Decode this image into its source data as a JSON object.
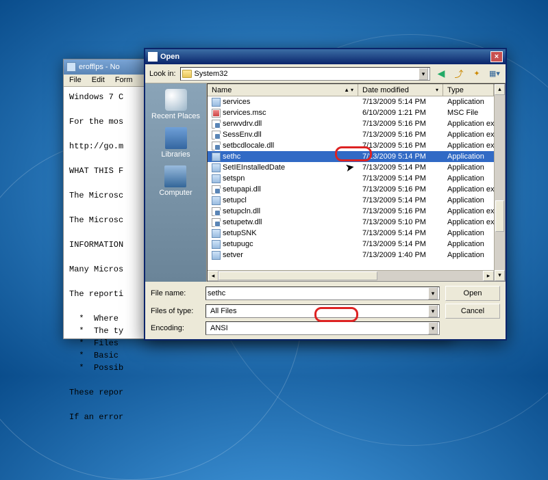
{
  "notepad": {
    "title": "erofflps - No",
    "menu": [
      "File",
      "Edit",
      "Form"
    ],
    "lines": [
      "Windows 7 C",
      "",
      "For the mos",
      "",
      "http://go.m",
      "",
      "WHAT THIS F",
      "",
      "The Microsc",
      "",
      "The Microsc",
      "",
      "INFORMATION",
      "",
      "Many Micros",
      "",
      "The reporti",
      "",
      "  *  Where",
      "  *  The ty",
      "  *  Files",
      "  *  Basic",
      "  *  Possib",
      "",
      "These repor",
      "",
      "If an error"
    ]
  },
  "dialog": {
    "title": "Open",
    "lookin_label": "Look in:",
    "lookin_value": "System32",
    "places": [
      "Recent Places",
      "Libraries",
      "Computer"
    ],
    "columns": {
      "name": "Name",
      "date": "Date modified",
      "type": "Type"
    },
    "col_w": {
      "name": 220,
      "date": 124,
      "type": 110
    },
    "files": [
      {
        "name": "services",
        "date": "7/13/2009 5:14 PM",
        "type": "Application",
        "ico": "exe"
      },
      {
        "name": "services.msc",
        "date": "6/10/2009 1:21 PM",
        "type": "MSC File",
        "ico": "msc"
      },
      {
        "name": "serwvdrv.dll",
        "date": "7/13/2009 5:16 PM",
        "type": "Application exte..",
        "ico": "dll"
      },
      {
        "name": "SessEnv.dll",
        "date": "7/13/2009 5:16 PM",
        "type": "Application exte..",
        "ico": "dll"
      },
      {
        "name": "setbcdlocale.dll",
        "date": "7/13/2009 5:16 PM",
        "type": "Application exte..",
        "ico": "dll"
      },
      {
        "name": "sethc",
        "date": "7/13/2009 5:14 PM",
        "type": "Application",
        "ico": "exe",
        "selected": true
      },
      {
        "name": "SetIEInstalledDate",
        "date": "7/13/2009 5:14 PM",
        "type": "Application",
        "ico": "exe"
      },
      {
        "name": "setspn",
        "date": "7/13/2009 5:14 PM",
        "type": "Application",
        "ico": "exe"
      },
      {
        "name": "setupapi.dll",
        "date": "7/13/2009 5:16 PM",
        "type": "Application exte..",
        "ico": "dll"
      },
      {
        "name": "setupcl",
        "date": "7/13/2009 5:14 PM",
        "type": "Application",
        "ico": "exe"
      },
      {
        "name": "setupcln.dll",
        "date": "7/13/2009 5:16 PM",
        "type": "Application exte..",
        "ico": "dll"
      },
      {
        "name": "setupetw.dll",
        "date": "7/13/2009 5:10 PM",
        "type": "Application exte..",
        "ico": "dll"
      },
      {
        "name": "setupSNK",
        "date": "7/13/2009 5:14 PM",
        "type": "Application",
        "ico": "exe"
      },
      {
        "name": "setupugc",
        "date": "7/13/2009 5:14 PM",
        "type": "Application",
        "ico": "exe"
      },
      {
        "name": "setver",
        "date": "7/13/2009 1:40 PM",
        "type": "Application",
        "ico": "exe"
      }
    ],
    "filename_label": "File name:",
    "filename_value": "sethc",
    "filetype_label": "Files of type:",
    "filetype_value": "All Files",
    "encoding_label": "Encoding:",
    "encoding_value": "ANSI",
    "open_btn": "Open",
    "cancel_btn": "Cancel"
  }
}
